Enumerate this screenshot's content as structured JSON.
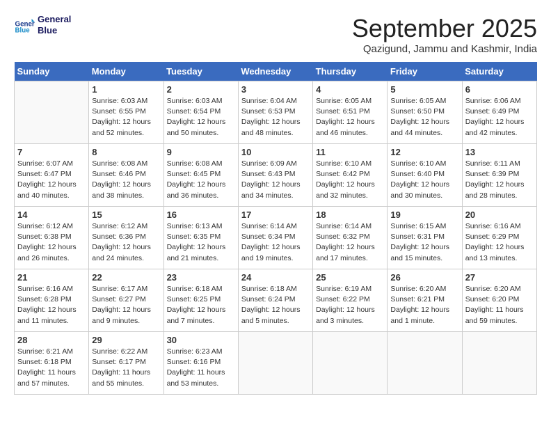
{
  "header": {
    "logo_line1": "General",
    "logo_line2": "Blue",
    "month_title": "September 2025",
    "subtitle": "Qazigund, Jammu and Kashmir, India"
  },
  "weekdays": [
    "Sunday",
    "Monday",
    "Tuesday",
    "Wednesday",
    "Thursday",
    "Friday",
    "Saturday"
  ],
  "weeks": [
    [
      {
        "day": "",
        "info": ""
      },
      {
        "day": "1",
        "info": "Sunrise: 6:03 AM\nSunset: 6:55 PM\nDaylight: 12 hours\nand 52 minutes."
      },
      {
        "day": "2",
        "info": "Sunrise: 6:03 AM\nSunset: 6:54 PM\nDaylight: 12 hours\nand 50 minutes."
      },
      {
        "day": "3",
        "info": "Sunrise: 6:04 AM\nSunset: 6:53 PM\nDaylight: 12 hours\nand 48 minutes."
      },
      {
        "day": "4",
        "info": "Sunrise: 6:05 AM\nSunset: 6:51 PM\nDaylight: 12 hours\nand 46 minutes."
      },
      {
        "day": "5",
        "info": "Sunrise: 6:05 AM\nSunset: 6:50 PM\nDaylight: 12 hours\nand 44 minutes."
      },
      {
        "day": "6",
        "info": "Sunrise: 6:06 AM\nSunset: 6:49 PM\nDaylight: 12 hours\nand 42 minutes."
      }
    ],
    [
      {
        "day": "7",
        "info": "Sunrise: 6:07 AM\nSunset: 6:47 PM\nDaylight: 12 hours\nand 40 minutes."
      },
      {
        "day": "8",
        "info": "Sunrise: 6:08 AM\nSunset: 6:46 PM\nDaylight: 12 hours\nand 38 minutes."
      },
      {
        "day": "9",
        "info": "Sunrise: 6:08 AM\nSunset: 6:45 PM\nDaylight: 12 hours\nand 36 minutes."
      },
      {
        "day": "10",
        "info": "Sunrise: 6:09 AM\nSunset: 6:43 PM\nDaylight: 12 hours\nand 34 minutes."
      },
      {
        "day": "11",
        "info": "Sunrise: 6:10 AM\nSunset: 6:42 PM\nDaylight: 12 hours\nand 32 minutes."
      },
      {
        "day": "12",
        "info": "Sunrise: 6:10 AM\nSunset: 6:40 PM\nDaylight: 12 hours\nand 30 minutes."
      },
      {
        "day": "13",
        "info": "Sunrise: 6:11 AM\nSunset: 6:39 PM\nDaylight: 12 hours\nand 28 minutes."
      }
    ],
    [
      {
        "day": "14",
        "info": "Sunrise: 6:12 AM\nSunset: 6:38 PM\nDaylight: 12 hours\nand 26 minutes."
      },
      {
        "day": "15",
        "info": "Sunrise: 6:12 AM\nSunset: 6:36 PM\nDaylight: 12 hours\nand 24 minutes."
      },
      {
        "day": "16",
        "info": "Sunrise: 6:13 AM\nSunset: 6:35 PM\nDaylight: 12 hours\nand 21 minutes."
      },
      {
        "day": "17",
        "info": "Sunrise: 6:14 AM\nSunset: 6:34 PM\nDaylight: 12 hours\nand 19 minutes."
      },
      {
        "day": "18",
        "info": "Sunrise: 6:14 AM\nSunset: 6:32 PM\nDaylight: 12 hours\nand 17 minutes."
      },
      {
        "day": "19",
        "info": "Sunrise: 6:15 AM\nSunset: 6:31 PM\nDaylight: 12 hours\nand 15 minutes."
      },
      {
        "day": "20",
        "info": "Sunrise: 6:16 AM\nSunset: 6:29 PM\nDaylight: 12 hours\nand 13 minutes."
      }
    ],
    [
      {
        "day": "21",
        "info": "Sunrise: 6:16 AM\nSunset: 6:28 PM\nDaylight: 12 hours\nand 11 minutes."
      },
      {
        "day": "22",
        "info": "Sunrise: 6:17 AM\nSunset: 6:27 PM\nDaylight: 12 hours\nand 9 minutes."
      },
      {
        "day": "23",
        "info": "Sunrise: 6:18 AM\nSunset: 6:25 PM\nDaylight: 12 hours\nand 7 minutes."
      },
      {
        "day": "24",
        "info": "Sunrise: 6:18 AM\nSunset: 6:24 PM\nDaylight: 12 hours\nand 5 minutes."
      },
      {
        "day": "25",
        "info": "Sunrise: 6:19 AM\nSunset: 6:22 PM\nDaylight: 12 hours\nand 3 minutes."
      },
      {
        "day": "26",
        "info": "Sunrise: 6:20 AM\nSunset: 6:21 PM\nDaylight: 12 hours\nand 1 minute."
      },
      {
        "day": "27",
        "info": "Sunrise: 6:20 AM\nSunset: 6:20 PM\nDaylight: 11 hours\nand 59 minutes."
      }
    ],
    [
      {
        "day": "28",
        "info": "Sunrise: 6:21 AM\nSunset: 6:18 PM\nDaylight: 11 hours\nand 57 minutes."
      },
      {
        "day": "29",
        "info": "Sunrise: 6:22 AM\nSunset: 6:17 PM\nDaylight: 11 hours\nand 55 minutes."
      },
      {
        "day": "30",
        "info": "Sunrise: 6:23 AM\nSunset: 6:16 PM\nDaylight: 11 hours\nand 53 minutes."
      },
      {
        "day": "",
        "info": ""
      },
      {
        "day": "",
        "info": ""
      },
      {
        "day": "",
        "info": ""
      },
      {
        "day": "",
        "info": ""
      }
    ]
  ]
}
